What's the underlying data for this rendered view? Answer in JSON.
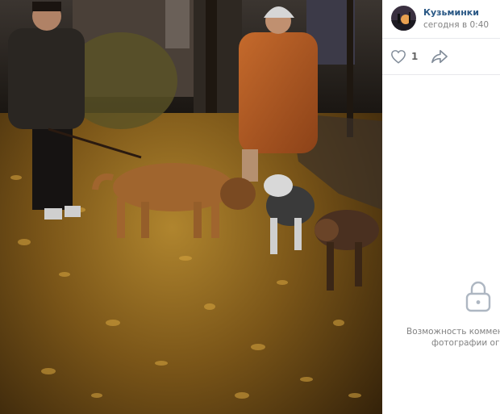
{
  "post": {
    "author": "Кузьминки",
    "time": "сегодня в 0:40",
    "likes": "1"
  },
  "comments": {
    "closed_line1": "Возможность комменти",
    "closed_line2": "фотографии огран"
  },
  "icons": {
    "like": "heart-icon",
    "share": "share-icon",
    "lock": "lock-icon"
  },
  "colors": {
    "link": "#2a5885",
    "muted": "#828282",
    "divider": "#e7e8ec"
  }
}
